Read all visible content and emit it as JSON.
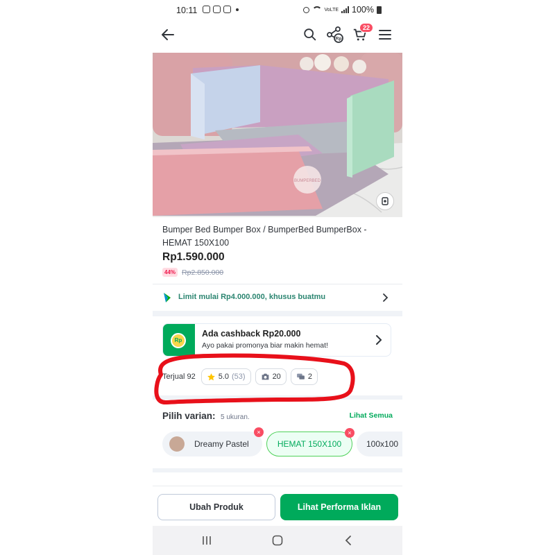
{
  "status_bar": {
    "time": "10:11",
    "volte_label": "VoLTE",
    "battery": "100%"
  },
  "nav": {
    "cart_count": "22",
    "share_label": "Rp"
  },
  "product": {
    "title": "Bumper Bed Bumper Box / BumperBed BumperBox - HEMAT 150X100",
    "price": "Rp1.590.000",
    "discount": "44%",
    "original_price": "Rp2.850.000",
    "image_watermark": "BUMPERBED"
  },
  "limit_banner": {
    "text": "Limit mulai Rp4.000.000, khusus buatmu"
  },
  "cashback": {
    "title": "Ada cashback Rp20.000",
    "subtitle": "Ayo pakai promonya biar makin hemat!",
    "coin_label": "Rp"
  },
  "stats": {
    "sold": "Terjual 92",
    "rating": "5.0",
    "rating_count": "(53)",
    "photos": "20",
    "discussions": "2"
  },
  "variants": {
    "title": "Pilih varian:",
    "count": "5 ukuran.",
    "see_all": "Lihat Semua",
    "items": [
      {
        "label": "Dreamy Pastel"
      },
      {
        "label": "HEMAT 150X100"
      },
      {
        "label": "100x100"
      }
    ]
  },
  "actions": {
    "edit_label": "Ubah Produk",
    "ads_label": "Lihat Performa Iklan"
  },
  "colors": {
    "accent_green": "#00aa5b",
    "badge_red": "#f94d63",
    "annotation_red": "#e8101a"
  }
}
